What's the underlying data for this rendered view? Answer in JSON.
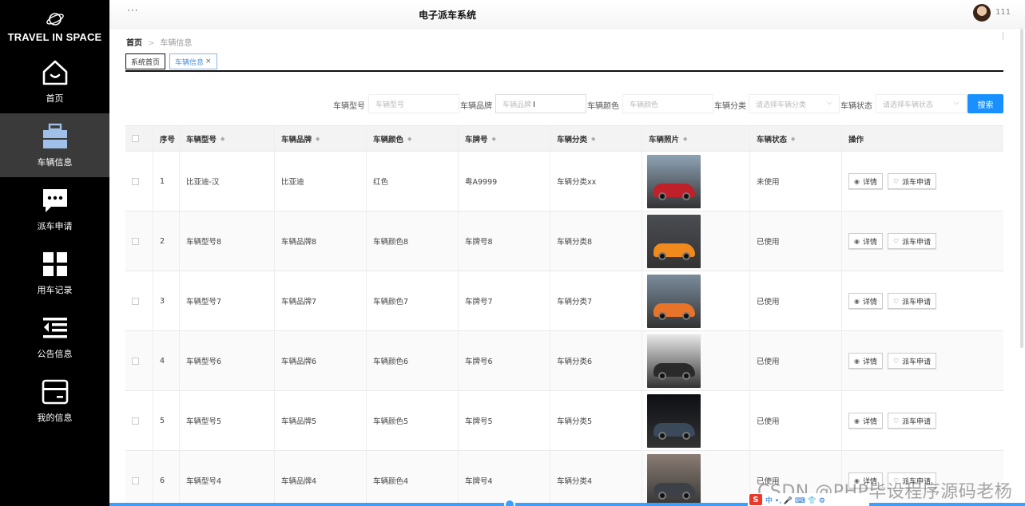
{
  "app": {
    "logo_text": "TRAVEL IN SPACE",
    "title": "电子派车系统",
    "menu_dots": "···",
    "username": "111"
  },
  "sidebar": {
    "items": [
      {
        "label": "首页",
        "icon": "home-icon"
      },
      {
        "label": "车辆信息",
        "icon": "car-info-icon",
        "active": true
      },
      {
        "label": "派车申请",
        "icon": "chat-icon"
      },
      {
        "label": "用车记录",
        "icon": "grid-icon"
      },
      {
        "label": "公告信息",
        "icon": "list-icon"
      },
      {
        "label": "我的信息",
        "icon": "card-icon"
      }
    ]
  },
  "breadcrumb": {
    "home": "首页",
    "sep": ">",
    "current": "车辆信息"
  },
  "tabs": [
    {
      "label": "系统首页"
    },
    {
      "label": "车辆信息",
      "close": "×"
    }
  ],
  "search": {
    "model_label": "车辆型号",
    "model_placeholder": "车辆型号",
    "brand_label": "车辆品牌",
    "brand_placeholder": "车辆品牌",
    "color_label": "车辆颜色",
    "color_placeholder": "车辆颜色",
    "category_label": "车辆分类",
    "category_placeholder": "请选择车辆分类",
    "status_label": "车辆状态",
    "status_placeholder": "请选择车辆状态",
    "button": "搜索"
  },
  "table": {
    "headers": [
      "序号",
      "车辆型号",
      "车辆品牌",
      "车辆颜色",
      "车牌号",
      "车辆分类",
      "车辆照片",
      "车辆状态",
      "操作"
    ],
    "detail_label": "详情",
    "apply_label": "派车申请",
    "rows": [
      {
        "no": "1",
        "model": "比亚迪-汉",
        "brand": "比亚迪",
        "color": "红色",
        "plate": "粤A9999",
        "category": "车辆分类xx",
        "status": "未使用",
        "photo_color": "#c0202a",
        "bg": "#8fa3b5"
      },
      {
        "no": "2",
        "model": "车辆型号8",
        "brand": "车辆品牌8",
        "color": "车辆颜色8",
        "plate": "车牌号8",
        "category": "车辆分类8",
        "status": "已使用",
        "photo_color": "#f08a1c",
        "bg": "#4a4d52"
      },
      {
        "no": "3",
        "model": "车辆型号7",
        "brand": "车辆品牌7",
        "color": "车辆颜色7",
        "plate": "车牌号7",
        "category": "车辆分类7",
        "status": "已使用",
        "photo_color": "#e8742a",
        "bg": "#7b8c9c"
      },
      {
        "no": "4",
        "model": "车辆型号6",
        "brand": "车辆品牌6",
        "color": "车辆颜色6",
        "plate": "车牌号6",
        "category": "车辆分类6",
        "status": "已使用",
        "photo_color": "#2a2a2a",
        "bg": "#e8e8e8"
      },
      {
        "no": "5",
        "model": "车辆型号5",
        "brand": "车辆品牌5",
        "color": "车辆颜色5",
        "plate": "车牌号5",
        "category": "车辆分类5",
        "status": "已使用",
        "photo_color": "#3a4a5a",
        "bg": "#0d0f14"
      },
      {
        "no": "6",
        "model": "车辆型号4",
        "brand": "车辆品牌4",
        "color": "车辆颜色4",
        "plate": "车牌号4",
        "category": "车辆分类4",
        "status": "已使用",
        "photo_color": "#3c4148",
        "bg": "#8a7d74"
      }
    ]
  },
  "watermark": "CSDN @PHP毕设程序源码老杨",
  "ime": {
    "logo": "S",
    "text": "中 •, 🎤 ⌨ 👕 ⚙"
  }
}
